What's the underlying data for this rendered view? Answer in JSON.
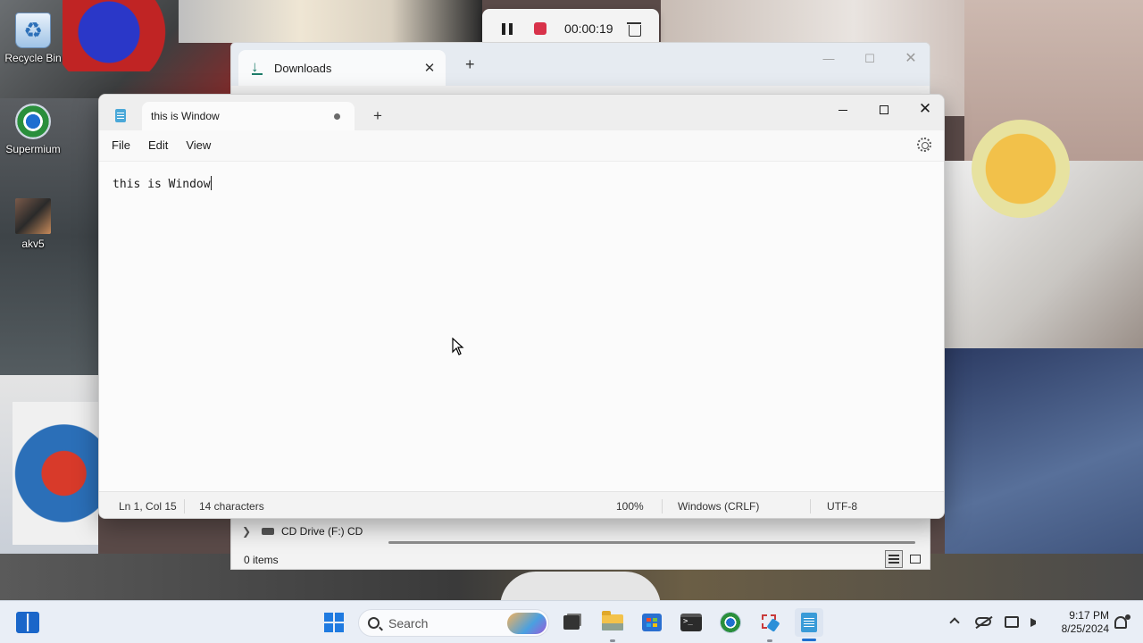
{
  "desktop": {
    "icons": [
      {
        "label": "Recycle Bin",
        "icon": "recycle-bin-icon"
      },
      {
        "label": "Supermium",
        "icon": "supermium-browser-icon"
      },
      {
        "label": "akv5",
        "icon": "image-file-icon"
      }
    ]
  },
  "recorder": {
    "time": "00:00:19",
    "pause_icon": "pause-icon",
    "stop_icon": "stop-record-icon",
    "delete_icon": "trash-icon",
    "stop_color": "#d8324a"
  },
  "explorer": {
    "tab_label": "Downloads",
    "tab_icon": "download-icon",
    "new_tab": "+",
    "close_symbol": "✕",
    "minimize_symbol": "—",
    "maximize_symbol": "☐",
    "nav_item": "CD Drive (F:) CD",
    "status": "0 items"
  },
  "notepad": {
    "tab_title": "this is Window",
    "unsaved_indicator": true,
    "new_tab": "+",
    "close_symbol": "✕",
    "menu": [
      "File",
      "Edit",
      "View"
    ],
    "content": "this is Window",
    "status": {
      "position": "Ln 1, Col 15",
      "characters": "14 characters",
      "zoom": "100%",
      "line_ending": "Windows (CRLF)",
      "encoding": "UTF-8"
    }
  },
  "taskbar": {
    "search_label": "Search",
    "apps": [
      "start-icon",
      "task-view-icon",
      "file-explorer-icon",
      "microsoft-store-icon",
      "terminal-icon",
      "supermium-browser-icon",
      "snipping-tool-icon",
      "notepad-icon"
    ],
    "accent": "#1f7ae0",
    "clock": {
      "time": "9:17 PM",
      "date": "8/25/2024"
    }
  }
}
